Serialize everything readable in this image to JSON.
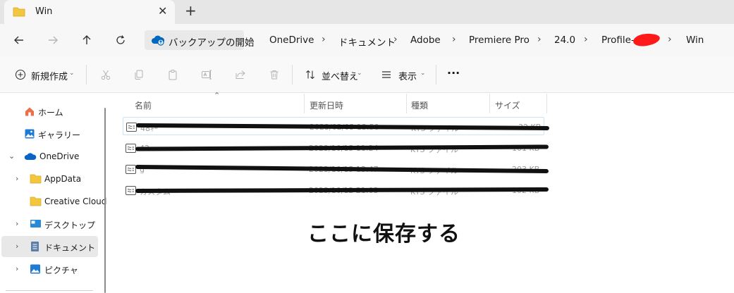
{
  "tab": {
    "title": "Win",
    "close": "✕",
    "new_tab": "+"
  },
  "address": {
    "backup_label": "バックアップの開始",
    "crumbs": [
      "OneDrive",
      "ドキュメント",
      "Adobe",
      "Premiere Pro",
      "24.0",
      "Profile-",
      "Win"
    ],
    "separator": "›"
  },
  "commands": {
    "new": "新規作成",
    "sort": "並べ替え",
    "view": "表示",
    "more": "···"
  },
  "sidebar": {
    "items": [
      {
        "label": "ホーム",
        "icon": "home-icon"
      },
      {
        "label": "ギャラリー",
        "icon": "gallery-icon"
      },
      {
        "label": "OneDrive",
        "icon": "cloud-icon",
        "expanded": true
      },
      {
        "label": "AppData",
        "icon": "folder-icon"
      },
      {
        "label": "Creative Cloud",
        "icon": "folder-icon"
      },
      {
        "label": "デスクトップ",
        "icon": "desktop-icon"
      },
      {
        "label": "ドキュメント",
        "icon": "documents-icon",
        "selected": true
      },
      {
        "label": "ピクチャ",
        "icon": "pictures-icon"
      }
    ]
  },
  "filelist": {
    "columns": {
      "name": "名前",
      "modified": "更新日時",
      "type": "種類",
      "size": "サイズ"
    },
    "rows": [
      {
        "name": "48ｷｰ",
        "modified": "2023/02/05 13:50",
        "type": "KYS ファイル",
        "size": "32 KB"
      },
      {
        "name": "42",
        "modified": "2023/10/15 11:24",
        "type": "KYS ファイル",
        "size": "101 KB"
      },
      {
        "name": "g",
        "modified": "2023/10/15 13:47",
        "type": "KYS ファイル",
        "size": "203 KB"
      },
      {
        "name": "カスタム",
        "modified": "2023/10/12 21:03",
        "type": "KYS ファイル",
        "size": "102 KB"
      }
    ],
    "note": "ここに保存する"
  },
  "colors": {
    "accent": "#0067c0",
    "folder": "#f3c63f",
    "redaction": "#ff1a1a",
    "scribble": "#111111"
  }
}
